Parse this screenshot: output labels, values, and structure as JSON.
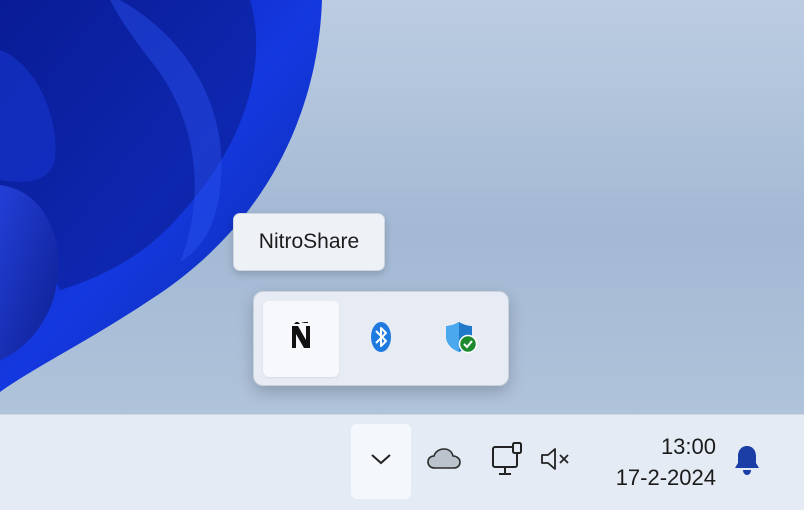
{
  "tooltip": {
    "text": "NitroShare"
  },
  "flyout": {
    "icons": [
      {
        "name": "nitroshare-icon",
        "active": true
      },
      {
        "name": "bluetooth-icon",
        "active": false
      },
      {
        "name": "windows-security-icon",
        "active": false
      }
    ]
  },
  "taskbar": {
    "chevron_icon": "chevron-down-icon",
    "onedrive_icon": "cloud-icon",
    "network_icon": "ethernet-icon",
    "volume_icon": "volume-muted-icon",
    "time": "13:00",
    "date": "17-2-2024",
    "notification_icon": "bell-icon"
  },
  "colors": {
    "wallpaper_bloom": "#0a2fd0",
    "taskbar_bg": "#e4ebf4",
    "bluetooth_blue": "#1f7ae0",
    "shield_blue": "#1f78c8",
    "check_green": "#1e8a2e",
    "bell_blue": "#1a3ea6"
  }
}
